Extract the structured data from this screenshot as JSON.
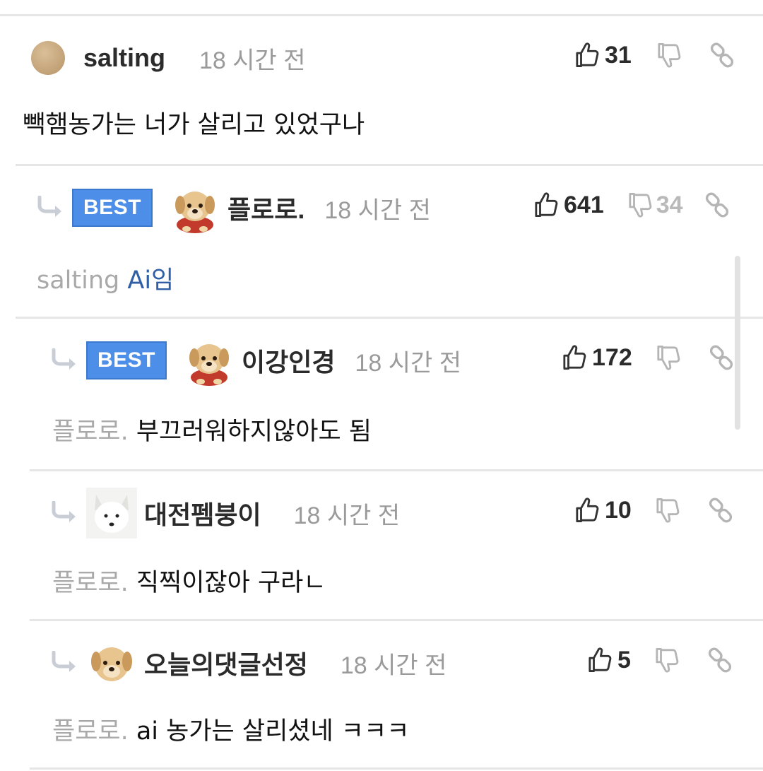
{
  "comments": [
    {
      "nickname": "salting",
      "time": "18 시간 전",
      "likes": "31",
      "dislikes": "",
      "best": "",
      "mention": "",
      "text": "빽햄농가는 너가 살리고 있었구나"
    },
    {
      "nickname": "플로로.",
      "time": "18 시간 전",
      "likes": "641",
      "dislikes": "34",
      "best": "BEST",
      "mention": "salting",
      "text": "Ai임"
    },
    {
      "nickname": "이강인경",
      "time": "18 시간 전",
      "likes": "172",
      "dislikes": "",
      "best": "BEST",
      "mention": "플로로.",
      "text": "부끄러워하지않아도 됨"
    },
    {
      "nickname": "대전펨붕이",
      "time": "18 시간 전",
      "likes": "10",
      "dislikes": "",
      "best": "",
      "mention": "플로로.",
      "text": "직찍이잖아 구라ㄴ"
    },
    {
      "nickname": "오늘의댓글선정",
      "time": "18 시간 전",
      "likes": "5",
      "dislikes": "",
      "best": "",
      "mention": "플로로.",
      "text": "ai 농가는 살리셨네 ㅋㅋㅋ"
    }
  ],
  "icons": {
    "like": "thumbs-up-icon",
    "dislike": "thumbs-down-icon",
    "link": "link-icon",
    "reply": "reply-arrow-icon"
  },
  "colors": {
    "best_badge": "#4d8fe8",
    "mention_link": "#2f5fa6",
    "muted": "#9a9a9a"
  }
}
